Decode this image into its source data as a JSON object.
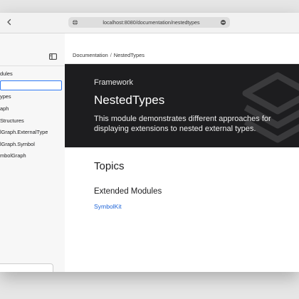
{
  "browser": {
    "url": "localhost:8080/documentation/nestedtypes",
    "back_icon": "chevron-left-icon",
    "lock_icon": "globe-icon"
  },
  "sidebar": {
    "toggle_icon": "sidebar-toggle-icon",
    "items": [
      {
        "label": "dules"
      },
      {
        "label": ""
      },
      {
        "label": "ypes"
      },
      {
        "label": "aph"
      },
      {
        "label": "Structures"
      },
      {
        "label": "lGraph.ExternalType"
      },
      {
        "label": "lGraph.Symbol"
      },
      {
        "label": "mbolGraph"
      }
    ],
    "filter_placeholder": ""
  },
  "breadcrumb": {
    "root": "Documentation",
    "separator": "/",
    "current": "NestedTypes"
  },
  "hero": {
    "eyebrow": "Framework",
    "title": "NestedTypes",
    "abstract": "This module demonstrates different approaches for displaying extensions to nested external types."
  },
  "topics": {
    "title": "Topics",
    "group_title": "Extended Modules",
    "links": [
      "SymbolKit"
    ]
  },
  "colors": {
    "hero_bg": "#1d1d1f",
    "link": "#2166d8",
    "focus": "#2f7af5"
  }
}
